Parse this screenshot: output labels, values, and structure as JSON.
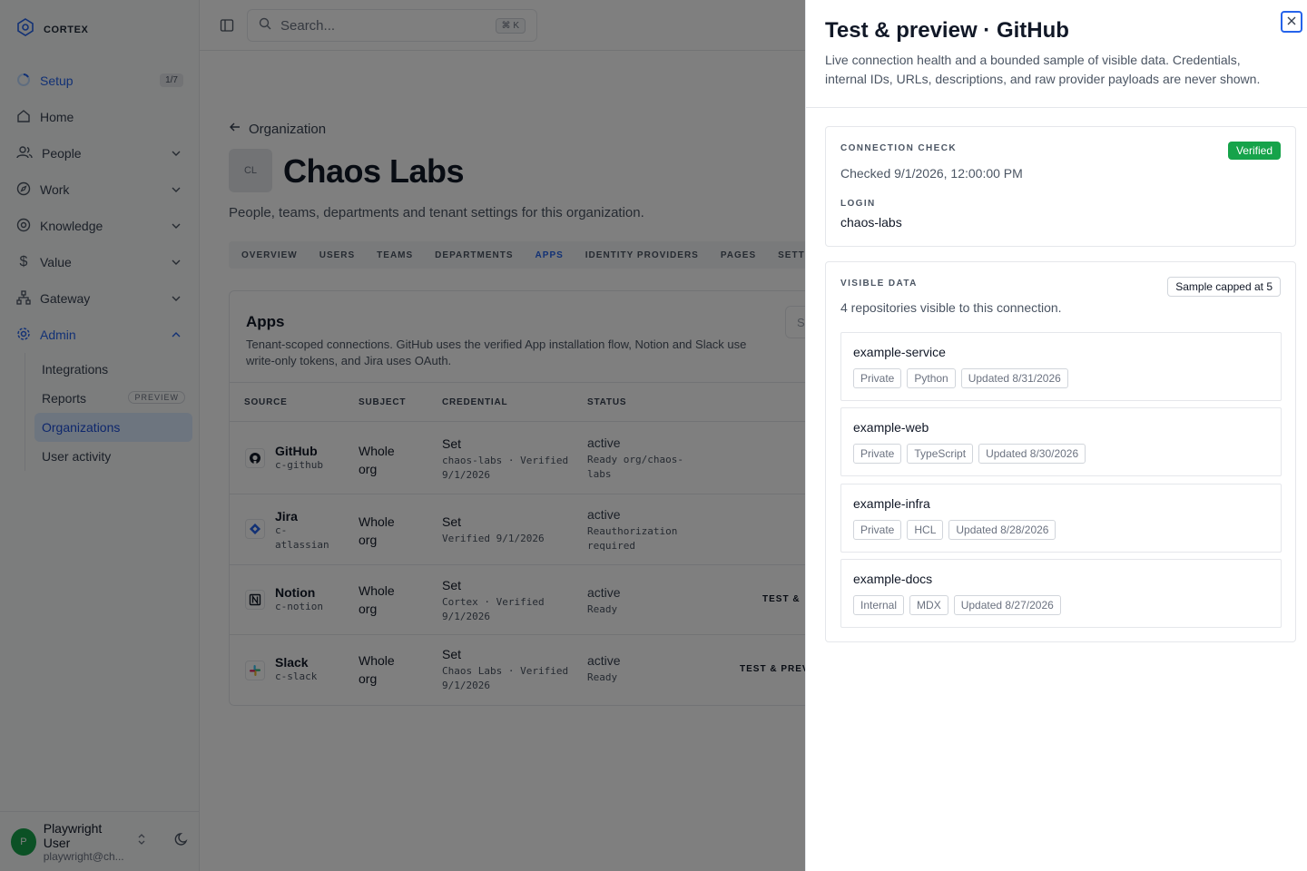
{
  "brand": {
    "name": "CORTEX"
  },
  "nav": {
    "setup": {
      "label": "Setup",
      "count": "1/7"
    },
    "home": {
      "label": "Home"
    },
    "people": {
      "label": "People"
    },
    "work": {
      "label": "Work"
    },
    "knowledge": {
      "label": "Knowledge"
    },
    "value": {
      "label": "Value"
    },
    "gateway": {
      "label": "Gateway"
    },
    "admin": {
      "label": "Admin"
    },
    "admin_items": [
      {
        "label": "Integrations"
      },
      {
        "label": "Reports",
        "badge": "PREVIEW"
      },
      {
        "label": "Organizations"
      },
      {
        "label": "User activity"
      }
    ]
  },
  "user": {
    "initial": "P",
    "name": "Playwright User",
    "email": "playwright@ch..."
  },
  "topbar": {
    "search_placeholder": "Search...",
    "shortcut": "⌘ K"
  },
  "org": {
    "back_label": "Organization",
    "initials": "CL",
    "name": "Chaos Labs",
    "description": "People, teams, departments and tenant settings for this organization.",
    "tabs": [
      "OVERVIEW",
      "USERS",
      "TEAMS",
      "DEPARTMENTS",
      "APPS",
      "IDENTITY PROVIDERS",
      "PAGES",
      "SETTINGS"
    ]
  },
  "apps": {
    "title": "Apps",
    "description": "Tenant-scoped connections. GitHub uses the verified App installation flow, Notion and Slack use write-only tokens, and Jira uses OAuth.",
    "search_placeholder": "S",
    "columns": {
      "source": "SOURCE",
      "subject": "SUBJECT",
      "credential": "CREDENTIAL",
      "status": "STATUS"
    },
    "rows": [
      {
        "name": "GitHub",
        "id": "c-github",
        "subject": "Whole org",
        "cred": "Set",
        "cred_detail": "chaos-labs · Verified 9/1/2026",
        "status": "active",
        "status_detail": "Ready org/chaos-labs",
        "action": ""
      },
      {
        "name": "Jira",
        "id": "c-atlassian",
        "subject": "Whole org",
        "cred": "Set",
        "cred_detail": "Verified 9/1/2026",
        "status": "active",
        "status_detail": "Reauthorization required",
        "action": ""
      },
      {
        "name": "Notion",
        "id": "c-notion",
        "subject": "Whole org",
        "cred": "Set",
        "cred_detail": "Cortex · Verified 9/1/2026",
        "status": "active",
        "status_detail": "Ready",
        "action": "TEST &"
      },
      {
        "name": "Slack",
        "id": "c-slack",
        "subject": "Whole org",
        "cred": "Set",
        "cred_detail": "Chaos Labs · Verified 9/1/2026",
        "status": "active",
        "status_detail": "Ready",
        "action": "TEST & PREV"
      }
    ]
  },
  "panel": {
    "title": "Test & preview · GitHub",
    "description": "Live connection health and a bounded sample of visible data. Credentials, internal IDs, URLs, descriptions, and raw provider payloads are never shown.",
    "connection": {
      "label": "CONNECTION CHECK",
      "badge": "Verified",
      "checked": "Checked 9/1/2026, 12:00:00 PM",
      "login_label": "LOGIN",
      "login": "chaos-labs"
    },
    "visible": {
      "label": "VISIBLE DATA",
      "badge": "Sample capped at 5",
      "summary": "4 repositories visible to this connection.",
      "repos": [
        {
          "name": "example-service",
          "visibility": "Private",
          "language": "Python",
          "updated": "Updated 8/31/2026"
        },
        {
          "name": "example-web",
          "visibility": "Private",
          "language": "TypeScript",
          "updated": "Updated 8/30/2026"
        },
        {
          "name": "example-infra",
          "visibility": "Private",
          "language": "HCL",
          "updated": "Updated 8/28/2026"
        },
        {
          "name": "example-docs",
          "visibility": "Internal",
          "language": "MDX",
          "updated": "Updated 8/27/2026"
        }
      ]
    }
  },
  "colors": {
    "accent": "#2563eb",
    "success": "#16a34a",
    "overlay": "rgba(0,0,0,0.5)"
  }
}
